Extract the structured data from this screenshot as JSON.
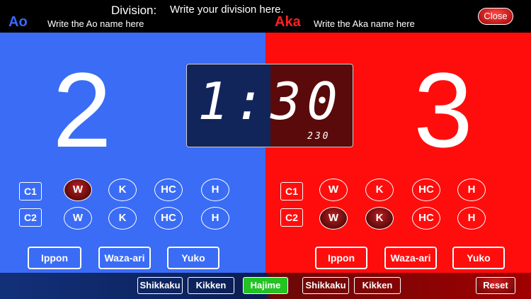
{
  "header": {
    "division_label": "Division:",
    "division_value": "Write your division here.",
    "ao_title": "Ao",
    "ao_name": "Write the Ao name here",
    "aka_title": "Aka",
    "aka_name": "Write the Aka name here",
    "close_label": "Close"
  },
  "scores": {
    "ao": "2",
    "aka": "3"
  },
  "timer": {
    "main": "1:30",
    "sub": "230"
  },
  "penalties": {
    "c1_label": "C1",
    "c2_label": "C2",
    "w": "W",
    "k": "K",
    "hc": "HC",
    "h": "H"
  },
  "actions": {
    "ippon": "Ippon",
    "wazaari": "Waza-ari",
    "yuko": "Yuko"
  },
  "bottom": {
    "shikkaku": "Shikkaku",
    "kikken": "Kikken",
    "hajime": "Hajime",
    "reset": "Reset"
  },
  "colors": {
    "ao": "#3a6cf5",
    "aka": "#ff0d0d",
    "hajime": "#22c322"
  }
}
